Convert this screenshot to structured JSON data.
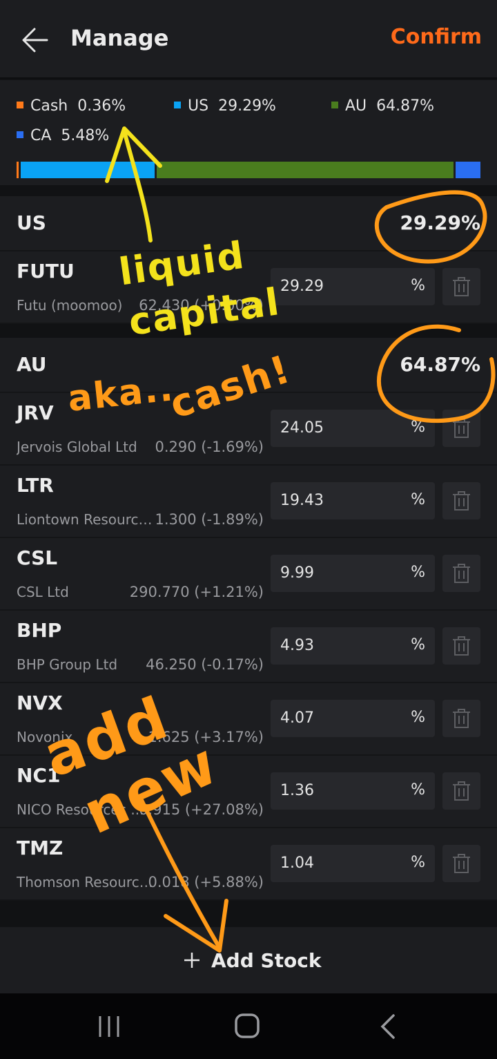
{
  "header": {
    "title": "Manage",
    "confirm_label": "Confirm"
  },
  "allocation": {
    "legend": [
      {
        "label": "Cash",
        "pct": "0.36%",
        "color": "#ff7a1a",
        "fraction": 0.0036
      },
      {
        "label": "US",
        "pct": "29.29%",
        "color": "#0aa3f5",
        "fraction": 0.2929
      },
      {
        "label": "AU",
        "pct": "64.87%",
        "color": "#4a7d1e",
        "fraction": 0.6487
      },
      {
        "label": "CA",
        "pct": "5.48%",
        "color": "#2a6ef2",
        "fraction": 0.0548
      }
    ]
  },
  "regions": [
    {
      "name": "US",
      "pct": "29.29%",
      "stocks": [
        {
          "ticker": "FUTU",
          "name": "Futu (moomoo)",
          "quote": "62.430 (+0.00%)",
          "weight": "29.29",
          "unit": "%"
        }
      ]
    },
    {
      "name": "AU",
      "pct": "64.87%",
      "stocks": [
        {
          "ticker": "JRV",
          "name": "Jervois Global Ltd",
          "quote": "0.290 (-1.69%)",
          "weight": "24.05",
          "unit": "%"
        },
        {
          "ticker": "LTR",
          "name": "Liontown Resources...",
          "quote": "1.300 (-1.89%)",
          "weight": "19.43",
          "unit": "%"
        },
        {
          "ticker": "CSL",
          "name": "CSL Ltd",
          "quote": "290.770 (+1.21%)",
          "weight": "9.99",
          "unit": "%"
        },
        {
          "ticker": "BHP",
          "name": "BHP Group Ltd",
          "quote": "46.250 (-0.17%)",
          "weight": "4.93",
          "unit": "%"
        },
        {
          "ticker": "NVX",
          "name": "Novonix",
          "quote": "1.625 (+3.17%)",
          "weight": "4.07",
          "unit": "%"
        },
        {
          "ticker": "NC1",
          "name": "NICO Resources ...",
          "quote": "0.915 (+27.08%)",
          "weight": "1.36",
          "unit": "%"
        },
        {
          "ticker": "TMZ",
          "name": "Thomson Resource...",
          "quote": "0.018 (+5.88%)",
          "weight": "1.04",
          "unit": "%"
        }
      ]
    }
  ],
  "add_stock": {
    "label": "Add Stock"
  },
  "icons": {
    "back": "arrow-left-icon",
    "trash": "trash-icon",
    "plus": "plus-icon",
    "nav_recent": "recent-apps-icon",
    "nav_home": "home-icon",
    "nav_back": "chevron-left-icon"
  },
  "annotations": {
    "yellow": [
      "liquid",
      "capital"
    ],
    "orange_1": "aka..",
    "orange_2": "cash!",
    "orange_3": [
      "add",
      "new"
    ]
  }
}
